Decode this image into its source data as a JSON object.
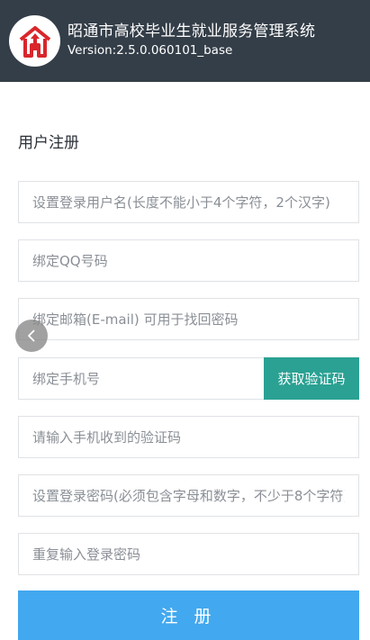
{
  "header": {
    "title": "昭通市高校毕业生就业服务管理系统",
    "version": "Version:2.5.0.060101_base",
    "logo_icon": "house-arrow-logo-icon",
    "logo_color": "#d9262b",
    "background": "#343e48"
  },
  "page": {
    "title": "用户注册"
  },
  "form": {
    "username_placeholder": "设置登录用户名(长度不能小于4个字符，2个汉字)",
    "qq_placeholder": "绑定QQ号码",
    "email_placeholder": "绑定邮箱(E-mail) 可用于找回密码",
    "phone_placeholder": "绑定手机号",
    "get_code_label": "获取验证码",
    "code_placeholder": "请输入手机收到的验证码",
    "password_placeholder": "设置登录密码(必须包含字母和数字，不少于8个字符)",
    "confirm_password_placeholder": "重复输入登录密码",
    "submit_label": "注 册"
  },
  "colors": {
    "accent_green": "#2aa193",
    "submit_blue": "#42a8ef"
  },
  "nav": {
    "back_icon": "chevron-left-icon"
  }
}
